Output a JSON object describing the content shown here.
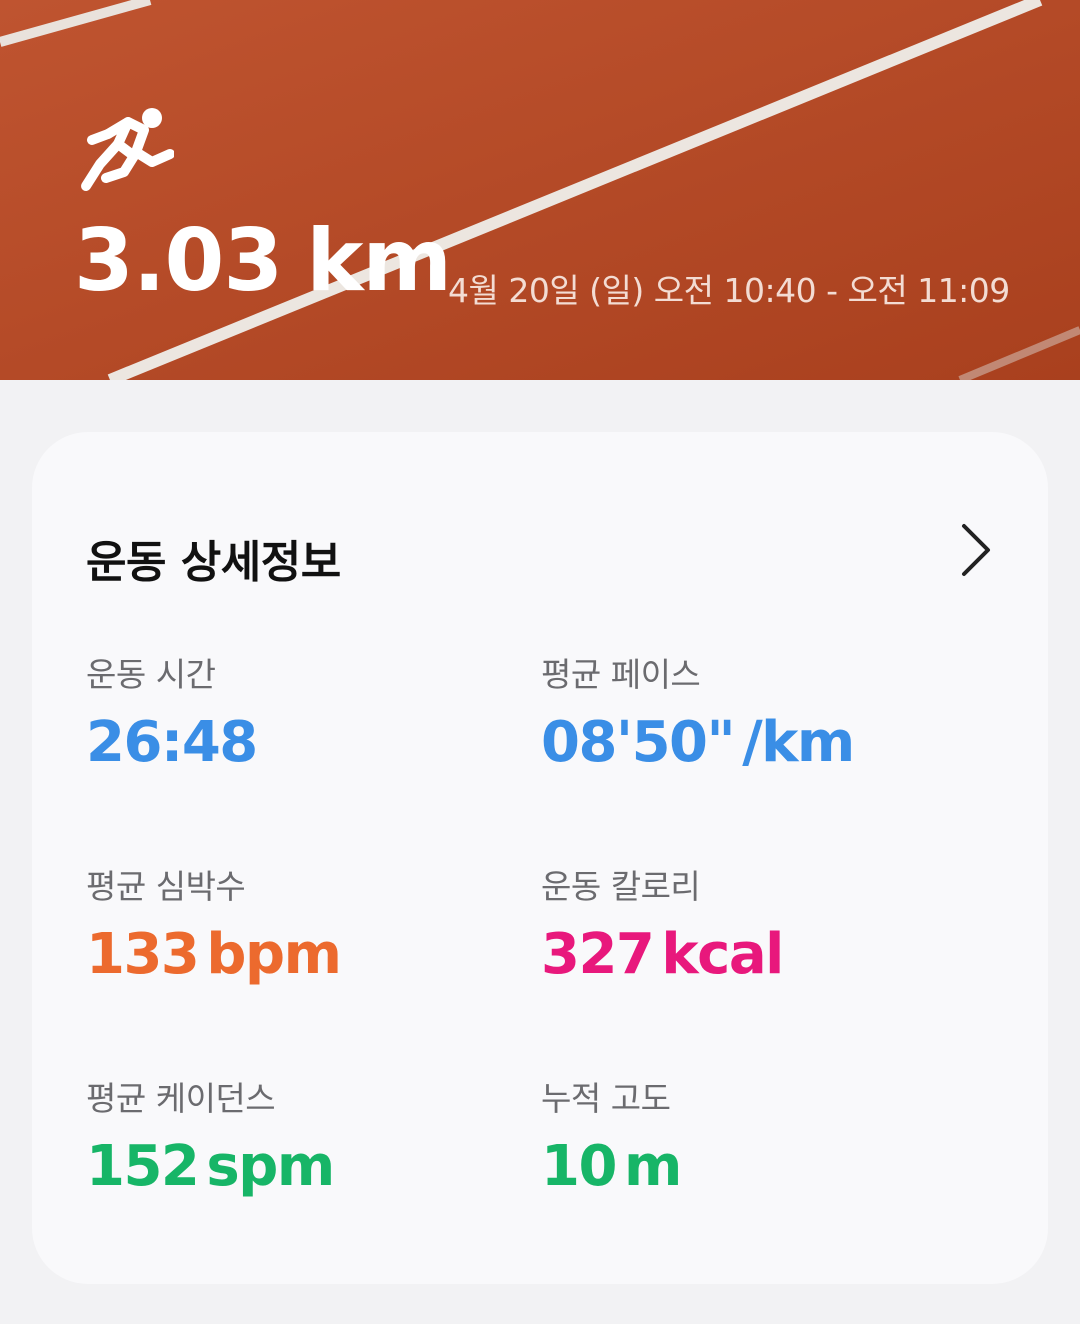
{
  "hero": {
    "icon": "running-person-icon",
    "distance_value": "3.03",
    "distance_unit": "km",
    "date_range": "4월 20일 (일) 오전 10:40 - 오전 11:09",
    "background_color": "#b64a26"
  },
  "details": {
    "title": "운동 상세정보",
    "more_icon": "chevron-right-icon",
    "stats": [
      {
        "label": "운동 시간",
        "value": "26:48",
        "unit": "",
        "color": "#3a8ee6"
      },
      {
        "label": "평균 페이스",
        "value": "08'50\"",
        "unit": "/km",
        "color": "#3a8ee6"
      },
      {
        "label": "평균 심박수",
        "value": "133",
        "unit": "bpm",
        "color": "#ec6a2e"
      },
      {
        "label": "운동 칼로리",
        "value": "327",
        "unit": "kcal",
        "color": "#e8187c"
      },
      {
        "label": "평균 케이던스",
        "value": "152",
        "unit": "spm",
        "color": "#17b567"
      },
      {
        "label": "누적 고도",
        "value": "10",
        "unit": "m",
        "color": "#17b567"
      }
    ]
  }
}
